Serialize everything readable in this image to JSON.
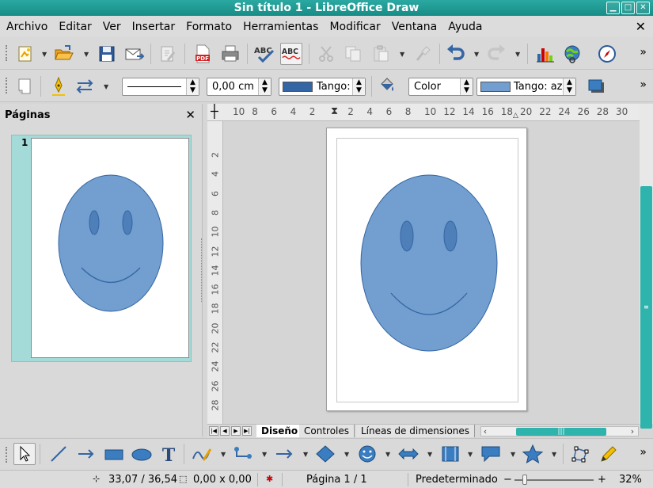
{
  "window": {
    "title": "Sin título 1 - LibreOffice Draw",
    "minimize_label": "▁",
    "maximize_label": "□",
    "close_label": "✕"
  },
  "menubar": {
    "items": [
      "Archivo",
      "Editar",
      "Ver",
      "Insertar",
      "Formato",
      "Herramientas",
      "Modificar",
      "Ventana",
      "Ayuda"
    ],
    "close_doc": "✕"
  },
  "toolbar2": {
    "line_style": "",
    "line_width": "0,00 cm",
    "line_color": "Tango:",
    "area_style": "Color",
    "area_color": "Tango: az"
  },
  "sidebar": {
    "title": "Páginas",
    "close": "✕",
    "page_number": "1"
  },
  "hruler": {
    "ticks": [
      "10",
      "8",
      "6",
      "4",
      "2",
      "",
      "2",
      "4",
      "6",
      "8",
      "10",
      "12",
      "14",
      "16",
      "18",
      "20",
      "22",
      "24",
      "26",
      "28",
      "30"
    ]
  },
  "vruler": {
    "ticks": [
      "2",
      "4",
      "6",
      "8",
      "10",
      "12",
      "14",
      "16",
      "18",
      "20",
      "22",
      "24",
      "26",
      "28"
    ]
  },
  "tabs": {
    "items": [
      "Diseño",
      "Controles",
      "Líneas de dimensiones"
    ],
    "active": "Diseño"
  },
  "statusbar": {
    "position": "33,07 / 36,54",
    "size": "0,00 x 0,00",
    "page": "Página 1 / 1",
    "layout": "Predeterminado",
    "zoom_minus": "−",
    "zoom_plus": "+",
    "zoom": "32%"
  },
  "colors": {
    "accent": "#2fb3ad",
    "shape_fill": "#729fcf",
    "shape_stroke": "#3465a4",
    "line_color_swatch": "#3465a4",
    "area_color_swatch": "#729fcf"
  }
}
